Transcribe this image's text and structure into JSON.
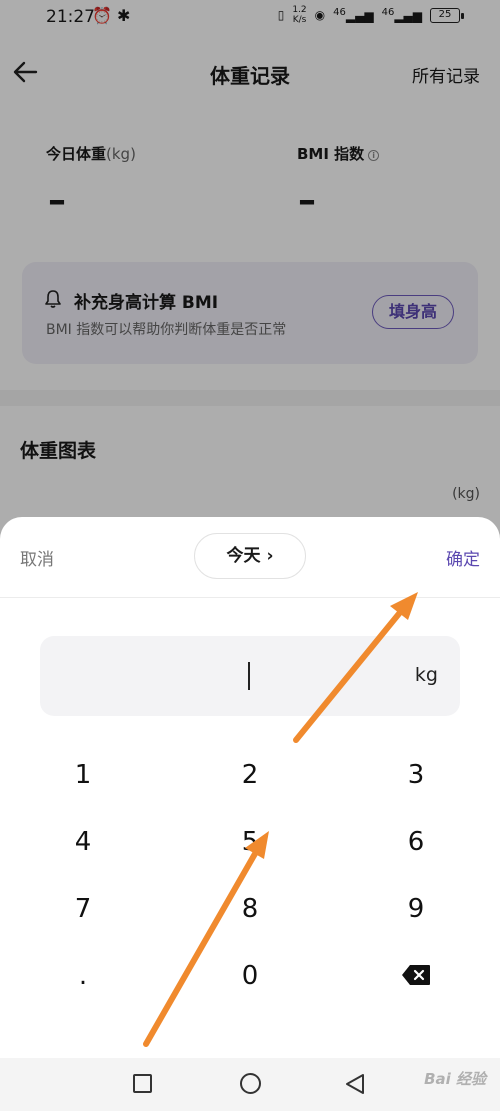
{
  "status_bar": {
    "time": "21:27",
    "left_icons": "⏰ ✱",
    "net_speed_top": "1.2",
    "net_speed_bottom": "K/s",
    "signal1": "46",
    "signal2": "46",
    "battery": "25"
  },
  "header": {
    "title": "体重记录",
    "all_records": "所有记录"
  },
  "stats": {
    "today_weight_label": "今日体重",
    "today_weight_unit": "(kg)",
    "today_weight_value": "–",
    "bmi_label": "BMI 指数",
    "bmi_value": "–"
  },
  "bmi_card": {
    "title": "补充身高计算 BMI",
    "subtitle": "BMI 指数可以帮助你判断体重是否正常",
    "button": "填身高"
  },
  "chart": {
    "title": "体重图表",
    "unit": "(kg)"
  },
  "sheet": {
    "cancel": "取消",
    "date": "今天 ›",
    "confirm": "确定",
    "input_unit": "kg"
  },
  "keypad": {
    "keys": [
      "1",
      "2",
      "3",
      "4",
      "5",
      "6",
      "7",
      "8",
      "9",
      ".",
      "0"
    ]
  },
  "watermark": "Bai 经验",
  "colors": {
    "accent": "#5b48b0",
    "card_bg": "#f1eff8",
    "arrow": "#f08a2e"
  }
}
